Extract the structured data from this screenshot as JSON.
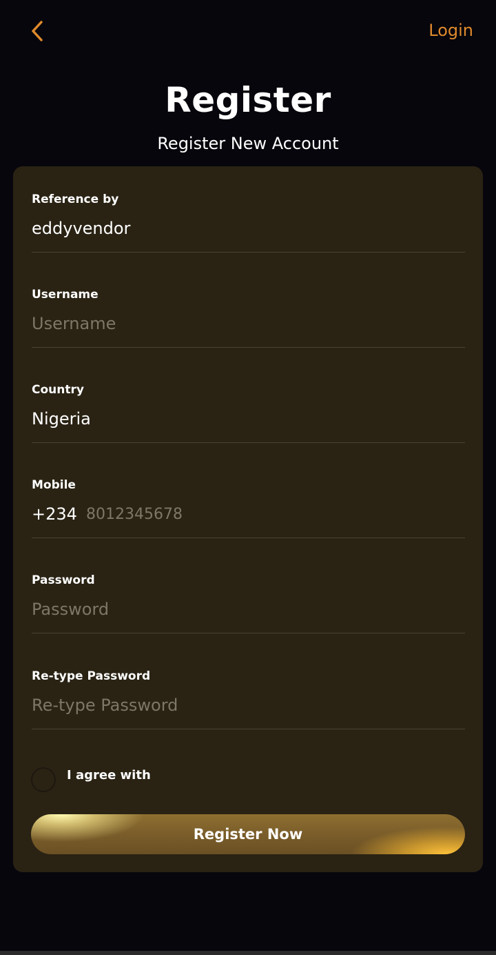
{
  "header": {
    "back_icon": "chevron-left-icon",
    "login_label": "Login",
    "title": "Register",
    "subtitle": "Register New Account"
  },
  "form": {
    "reference": {
      "label": "Reference by",
      "value": "eddyvendor"
    },
    "username": {
      "label": "Username",
      "placeholder": "Username",
      "value": ""
    },
    "country": {
      "label": "Country",
      "value": "Nigeria"
    },
    "mobile": {
      "label": "Mobile",
      "dial_code": "+234",
      "placeholder": "8012345678",
      "value": ""
    },
    "password": {
      "label": "Password",
      "placeholder": "Password",
      "value": ""
    },
    "retype_password": {
      "label": "Re-type Password",
      "placeholder": "Re-type Password",
      "value": ""
    },
    "agree_label": "I agree with",
    "agree_checked": false,
    "submit_label": "Register Now"
  },
  "colors": {
    "background": "#07060c",
    "card": "#2a2314",
    "accent": "#e08a2c",
    "placeholder": "#7d7768"
  }
}
